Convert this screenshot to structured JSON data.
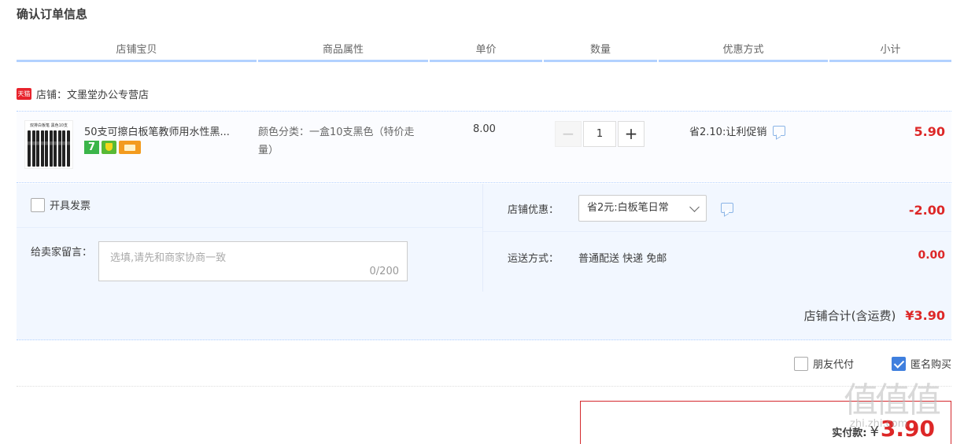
{
  "page": {
    "title": "确认订单信息"
  },
  "columns": [
    "店铺宝贝",
    "商品属性",
    "单价",
    "数量",
    "优惠方式",
    "小计"
  ],
  "shop": {
    "badge": "天猫",
    "label": "店铺：文墨堂办公专营店"
  },
  "item": {
    "thumb_text": "双排白板笔 黑色10支",
    "title": "50支可擦白板笔教师用水性黑...",
    "badges": [
      "7",
      "shield",
      "card"
    ],
    "attr": "颜色分类：一盒10支黑色（特价走量）",
    "price": "8.00",
    "qty_minus": "−",
    "qty": "1",
    "qty_plus": "+",
    "discount": "省2.10:让利促销",
    "subtotal": "5.90"
  },
  "invoice": {
    "label": "开具发票",
    "checked": false
  },
  "message": {
    "label": "给卖家留言：",
    "placeholder": "选填,请先和商家协商一致",
    "counter": "0/200"
  },
  "shop_coupon": {
    "label": "店铺优惠：",
    "selected": "省2元:白板笔日常",
    "amount": "-2.00"
  },
  "shipping": {
    "label": "运送方式：",
    "value": "普通配送 快递 免邮",
    "amount": "0.00"
  },
  "shop_total": {
    "label": "店铺合计(含运费)",
    "amount": "¥3.90"
  },
  "options": {
    "friend_pay": {
      "label": "朋友代付",
      "checked": false
    },
    "anonymous": {
      "label": "匿名购买",
      "checked": true
    }
  },
  "payment": {
    "label": "实付款:",
    "currency": "¥",
    "amount": "3.90"
  },
  "watermark": {
    "chars": "值值值",
    "url": "zhi.zhi.com"
  },
  "colors": {
    "accent_red": "#dd2727",
    "header_blue": "#b2d1ff",
    "panel_bg": "#f2f7ff",
    "check_blue": "#3f7fde"
  }
}
